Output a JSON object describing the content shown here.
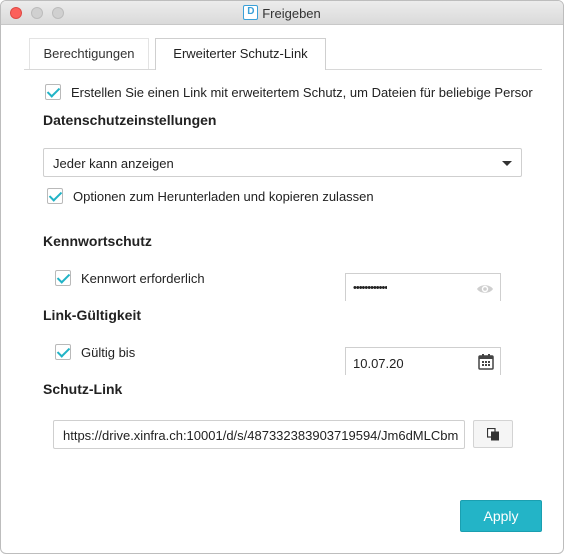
{
  "window": {
    "title": "Freigeben",
    "app_icon_letter": "D"
  },
  "tabs": [
    {
      "label": "Berechtigungen",
      "active": false
    },
    {
      "label": "Erweiterter Schutz-Link",
      "active": true
    }
  ],
  "main": {
    "enable_protected_link": {
      "label": "Erstellen Sie einen Link mit erweitertem Schutz, um Dateien für beliebige Persor",
      "checked": true
    },
    "privacy": {
      "heading": "Datenschutzeinstellungen",
      "visibility_selected": "Jeder kann anzeigen",
      "allow_download": {
        "label": "Optionen zum Herunterladen und kopieren zulassen",
        "checked": true
      }
    },
    "password": {
      "heading": "Kennwortschutz",
      "required": {
        "label": "Kennwort erforderlich",
        "checked": true
      },
      "value": "••••••••••••"
    },
    "validity": {
      "heading": "Link-Gültigkeit",
      "valid_until": {
        "label": "Gültig bis",
        "checked": true
      },
      "date": "10.07.20"
    },
    "link": {
      "heading": "Schutz-Link",
      "url": "https://drive.xinfra.ch:10001/d/s/487332383903719594/Jm6dMLCbm"
    }
  },
  "footer": {
    "apply_label": "Apply"
  },
  "colors": {
    "accent": "#23b4c7",
    "checkmark": "#21b3c6"
  },
  "icons": {
    "show_password": "eye-icon",
    "date_picker": "calendar-icon",
    "copy": "copy-icon",
    "dropdown": "chevron-down-icon"
  }
}
